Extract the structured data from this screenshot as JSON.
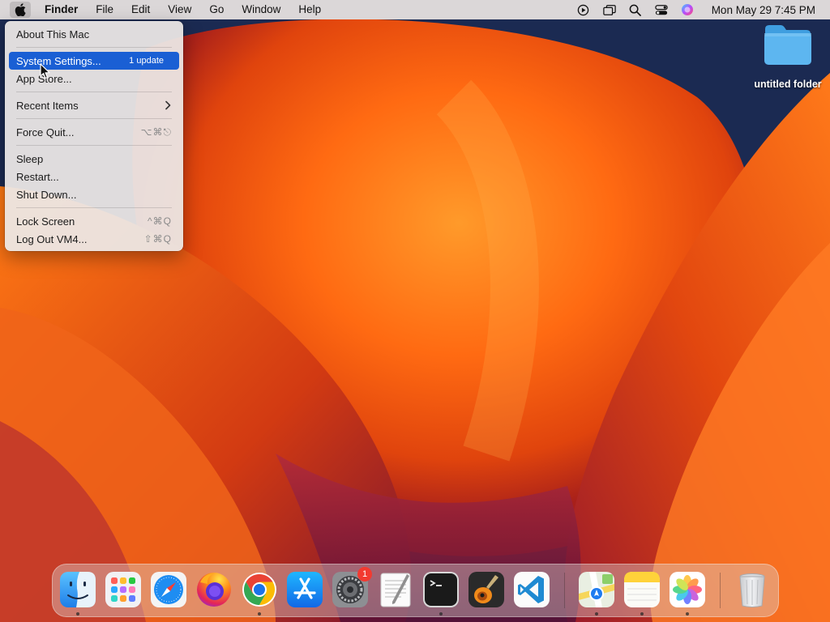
{
  "menubar": {
    "app_name": "Finder",
    "items": [
      "File",
      "Edit",
      "View",
      "Go",
      "Window",
      "Help"
    ],
    "clock": "Mon May 29  7:45 PM",
    "status_icons": [
      "screen-recording-icon",
      "screen-mirroring-icon",
      "spotlight-search-icon",
      "control-center-icon",
      "siri-icon"
    ]
  },
  "apple_menu": {
    "about": "About This Mac",
    "system_settings": "System Settings...",
    "system_settings_badge": "1 update",
    "app_store": "App Store...",
    "recent_items": "Recent Items",
    "force_quit": "Force Quit...",
    "force_quit_shortcut": "⌥⌘⎋",
    "sleep": "Sleep",
    "restart": "Restart...",
    "shut_down": "Shut Down...",
    "lock_screen": "Lock Screen",
    "lock_screen_shortcut": "^⌘Q",
    "log_out": "Log Out VM4...",
    "log_out_shortcut": "⇧⌘Q"
  },
  "desktop": {
    "folder_name": "untitled folder"
  },
  "dock": {
    "apps": [
      "Finder",
      "Launchpad",
      "Safari",
      "Firefox",
      "Google Chrome",
      "App Store",
      "System Settings",
      "TextEdit",
      "Terminal",
      "GarageBand",
      "Visual Studio Code",
      "Maps",
      "Notes",
      "Photos",
      "Trash"
    ],
    "system_settings_badge": "1",
    "running": [
      "Finder",
      "Google Chrome",
      "Terminal",
      "Maps",
      "Notes",
      "Photos"
    ]
  },
  "colors": {
    "selection": "#1a5fd4",
    "wallpaper_orange": "#ff6a14",
    "wallpaper_navy": "#1b2a52"
  }
}
